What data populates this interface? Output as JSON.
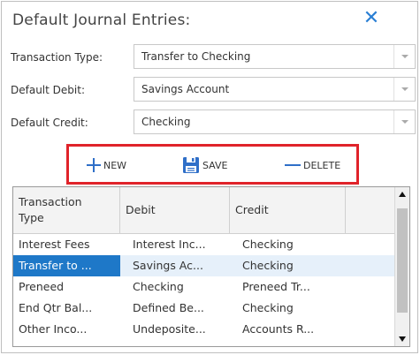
{
  "dialog": {
    "title": "Default Journal Entries:",
    "close_glyph": "✕"
  },
  "form": {
    "transaction_type": {
      "label": "Transaction Type:",
      "value": "Transfer to Checking"
    },
    "default_debit": {
      "label": "Default Debit:",
      "value": "Savings Account"
    },
    "default_credit": {
      "label": "Default Credit:",
      "value": "Checking"
    }
  },
  "toolbar": {
    "new_label": "NEW",
    "save_label": "SAVE",
    "delete_label": "DELETE",
    "highlight_color": "#e0232a",
    "icon_color": "#2f6fc8"
  },
  "grid": {
    "columns": [
      "Transaction\nType",
      "Debit",
      "Credit"
    ],
    "rows": [
      [
        "Interest Fees",
        "Interest Inc...",
        "Checking"
      ],
      [
        "Transfer to ...",
        "Savings Ac...",
        "Checking"
      ],
      [
        "Preneed",
        "Checking",
        "Preneed Tr..."
      ],
      [
        "End Qtr Bal...",
        "Defined Be...",
        "Checking"
      ],
      [
        "Other Inco...",
        "Undeposite...",
        "Accounts R..."
      ]
    ],
    "selected_row_index": 1,
    "selection_color": "#1e78c8"
  }
}
